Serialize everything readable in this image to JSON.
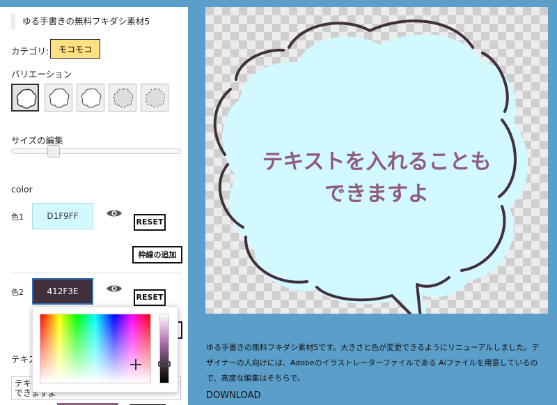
{
  "panel": {
    "title": "ゆる手書きの無料フキダシ素材5",
    "category_label": "カテゴリ:",
    "category_value": "モコモコ",
    "variation_label": "バリエーション",
    "size_label": "サイズの編集",
    "size_value": 0.25,
    "color_heading": "color",
    "color1_label": "色1",
    "color1_value": "D1F9FF",
    "color2_label": "色2",
    "color2_value": "412F3E",
    "reset_label": "RESET",
    "add_border_label": "枠線の追加",
    "text_label_partial": "テキス",
    "textarea_value": "テキストを入れることも\nできますよ"
  },
  "preview": {
    "bubble_text_line1": "テキストを入れることも",
    "bubble_text_line2": "できますよ",
    "bubble_fill": "#d1f9ff",
    "bubble_stroke": "#412f3e",
    "text_color": "#8f5b7e"
  },
  "description": "ゆる手書きの無料フキダシ素材5です。大きさと色が変更できるようにリニューアルしました。デザイナーの人向けには、Adobeのイラストレーターファイルである Aiファイルを用意しているので、高度な編集はそちらで。",
  "download_label": "DOWNLOAD",
  "icons": [
    "eye-icon",
    "crosshair-icon"
  ]
}
